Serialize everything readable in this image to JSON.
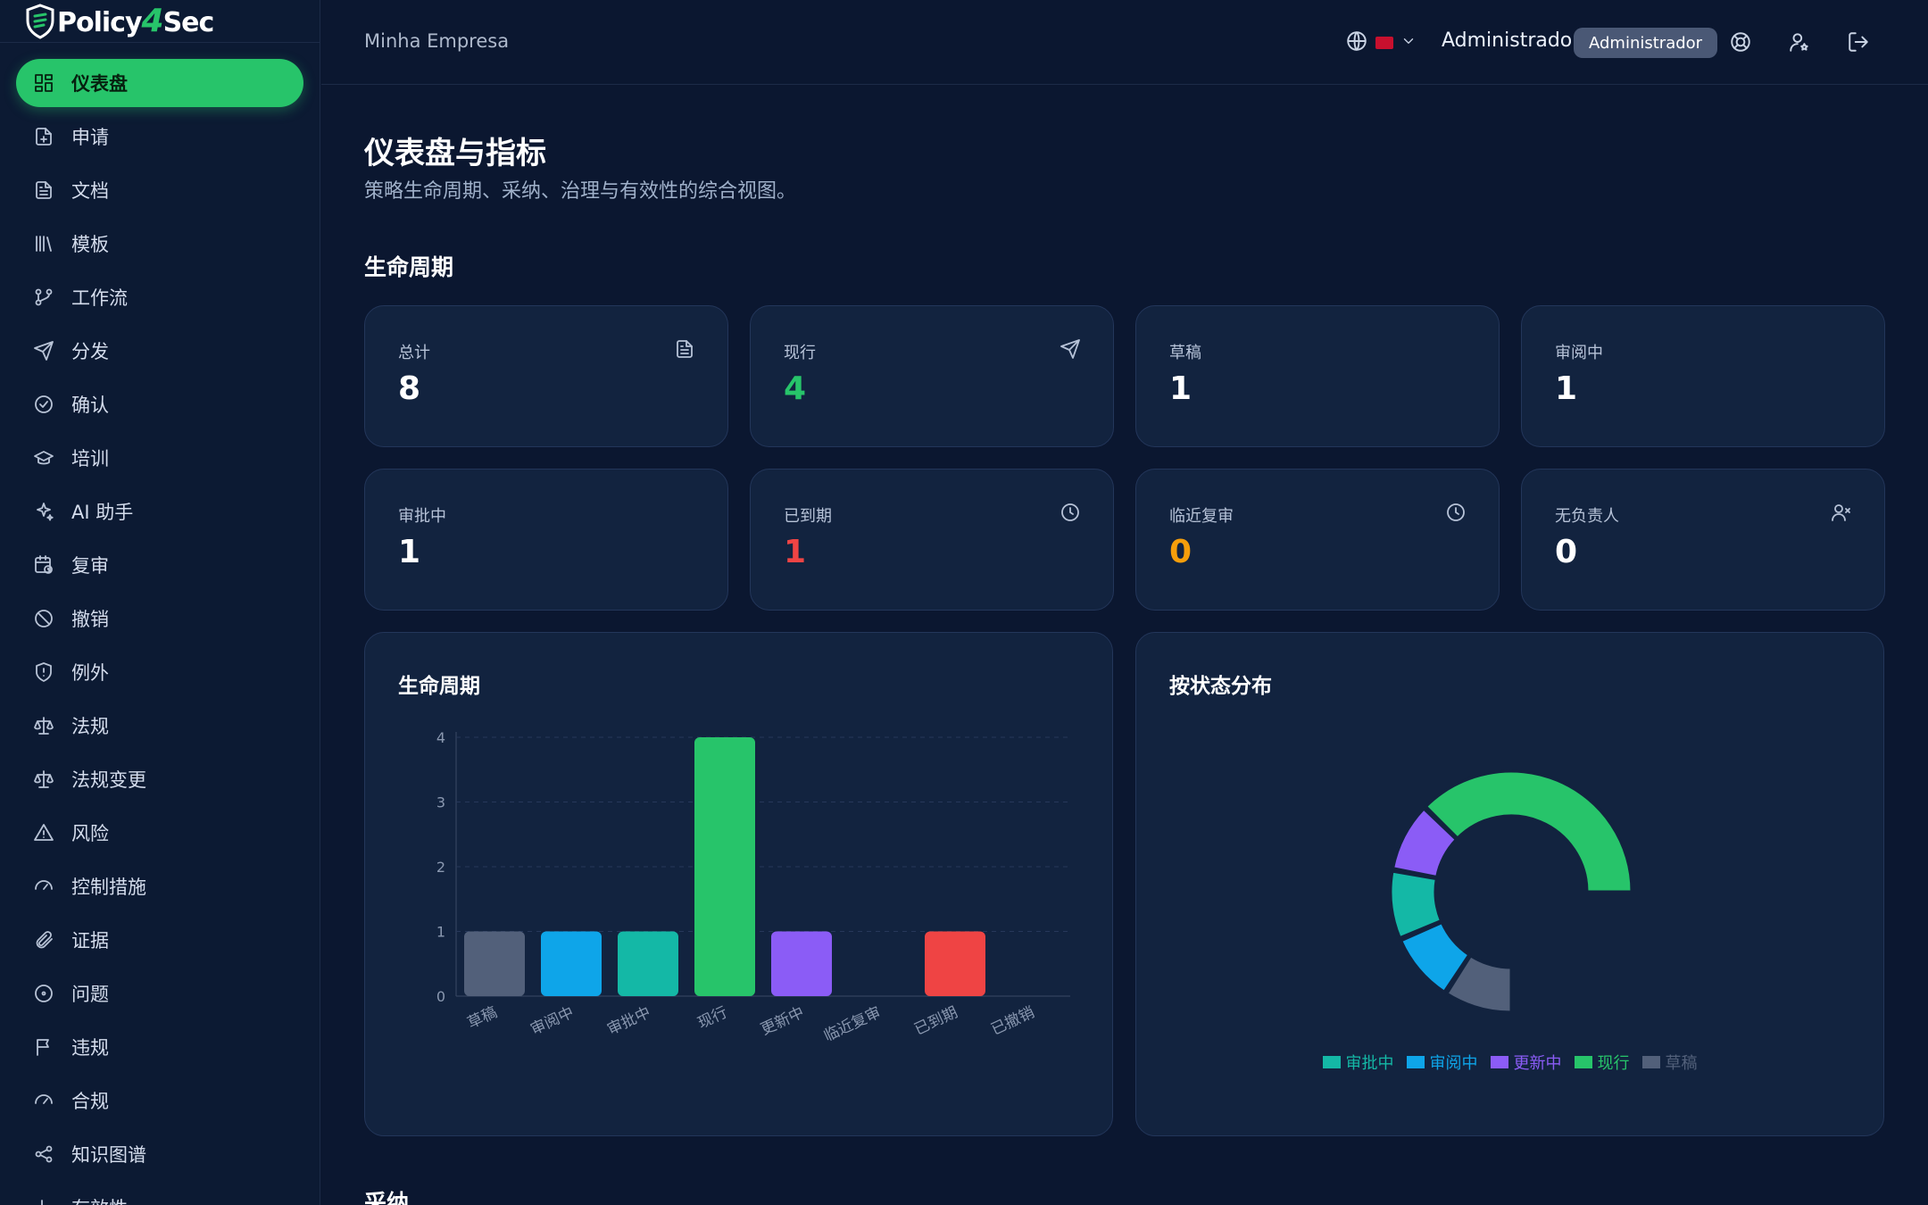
{
  "brand": {
    "name_part1": "Policy",
    "name_part2": "4",
    "name_part3": "Sec"
  },
  "sidebar": {
    "items": [
      {
        "label": "仪表盘",
        "icon": "dashboard-icon",
        "active": true
      },
      {
        "label": "申请",
        "icon": "file-plus-icon"
      },
      {
        "label": "文档",
        "icon": "document-icon"
      },
      {
        "label": "模板",
        "icon": "library-icon"
      },
      {
        "label": "工作流",
        "icon": "git-branch-icon"
      },
      {
        "label": "分发",
        "icon": "send-icon"
      },
      {
        "label": "确认",
        "icon": "check-circle-icon"
      },
      {
        "label": "培训",
        "icon": "graduation-cap-icon"
      },
      {
        "label": "AI 助手",
        "icon": "sparkles-icon"
      },
      {
        "label": "复审",
        "icon": "calendar-clock-icon"
      },
      {
        "label": "撤销",
        "icon": "ban-icon"
      },
      {
        "label": "例外",
        "icon": "shield-alert-icon"
      },
      {
        "label": "法规",
        "icon": "scale-icon"
      },
      {
        "label": "法规变更",
        "icon": "scale-change-icon"
      },
      {
        "label": "风险",
        "icon": "warning-icon"
      },
      {
        "label": "控制措施",
        "icon": "gauge-icon"
      },
      {
        "label": "证据",
        "icon": "paperclip-icon"
      },
      {
        "label": "问题",
        "icon": "circle-dot-icon"
      },
      {
        "label": "违规",
        "icon": "flag-icon"
      },
      {
        "label": "合规",
        "icon": "gauge-icon"
      },
      {
        "label": "知识图谱",
        "icon": "share-icon"
      },
      {
        "label": "有效性",
        "icon": "chart-icon"
      }
    ]
  },
  "header": {
    "company": "Minha Empresa",
    "user_name": "Administrador",
    "role": "Administrador"
  },
  "page": {
    "title": "仪表盘与指标",
    "subtitle": "策略生命周期、采纳、治理与有效性的综合视图。",
    "section_lifecycle": "生命周期",
    "section_adoption": "采纳"
  },
  "cards": [
    {
      "label": "总计",
      "value": "8",
      "color": "#ffffff",
      "icon": "document-icon"
    },
    {
      "label": "现行",
      "value": "4",
      "color": "#27c46a",
      "icon": "send-icon"
    },
    {
      "label": "草稿",
      "value": "1",
      "color": "#ffffff",
      "icon": ""
    },
    {
      "label": "审阅中",
      "value": "1",
      "color": "#ffffff",
      "icon": ""
    },
    {
      "label": "审批中",
      "value": "1",
      "color": "#ffffff",
      "icon": ""
    },
    {
      "label": "已到期",
      "value": "1",
      "color": "#ef4444",
      "icon": "clock-icon"
    },
    {
      "label": "临近复审",
      "value": "0",
      "color": "#f59e0b",
      "icon": "clock-icon"
    },
    {
      "label": "无负责人",
      "value": "0",
      "color": "#ffffff",
      "icon": "user-x-icon"
    }
  ],
  "panels": {
    "bar_title": "生命周期",
    "donut_title": "按状态分布"
  },
  "chart_data": [
    {
      "type": "bar",
      "title": "生命周期",
      "categories": [
        "草稿",
        "审阅中",
        "审批中",
        "现行",
        "更新中",
        "临近复审",
        "已到期",
        "已撤销"
      ],
      "values": [
        1,
        1,
        1,
        4,
        1,
        0,
        1,
        0
      ],
      "colors": [
        "#52607a",
        "#0ea5e9",
        "#14b8a6",
        "#27c46a",
        "#8b5cf6",
        "#f59e0b",
        "#ef4444",
        "#64748b"
      ],
      "ylim": [
        0,
        4
      ],
      "yticks": [
        0,
        1,
        2,
        3,
        4
      ],
      "grid": true
    },
    {
      "type": "pie",
      "title": "按状态分布",
      "slices": [
        {
          "label": "现行",
          "value": 4,
          "color": "#27c46a"
        },
        {
          "label": "更新中",
          "value": 1,
          "color": "#8b5cf6"
        },
        {
          "label": "审批中",
          "value": 1,
          "color": "#14b8a6"
        },
        {
          "label": "审阅中",
          "value": 1,
          "color": "#0ea5e9"
        },
        {
          "label": "草稿",
          "value": 1,
          "color": "#52607a"
        }
      ],
      "legend": [
        {
          "label": "审批中",
          "color": "#14b8a6"
        },
        {
          "label": "审阅中",
          "color": "#0ea5e9"
        },
        {
          "label": "更新中",
          "color": "#8b5cf6"
        },
        {
          "label": "现行",
          "color": "#27c46a"
        },
        {
          "label": "草稿",
          "color": "#52607a"
        }
      ],
      "legend_position": "bottom"
    }
  ]
}
